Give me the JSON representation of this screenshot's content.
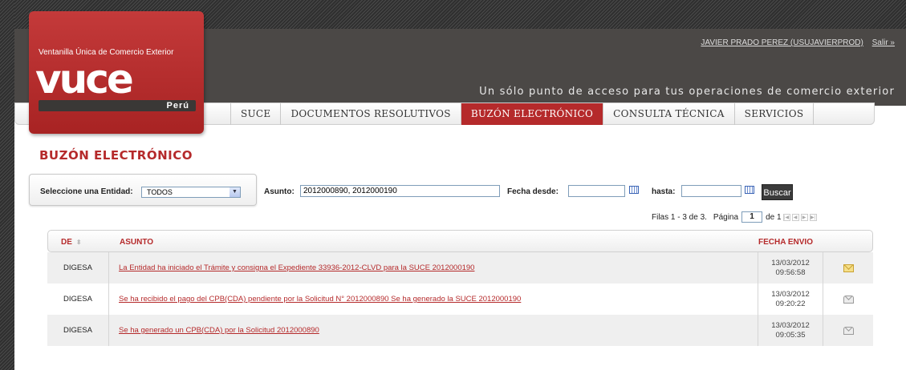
{
  "logo": {
    "top_text": "Ventanilla Única de Comercio Exterior",
    "word": "vuce",
    "country": "Perú"
  },
  "header": {
    "user": "JAVIER PRADO PEREZ (USUJAVIERPROD)",
    "logout": "Salir »",
    "tagline": "Un sólo punto de acceso para tus operaciones de comercio exterior"
  },
  "nav": [
    "SUCE",
    "DOCUMENTOS RESOLUTIVOS",
    "BUZÓN ELECTRÓNICO",
    "CONSULTA TÉCNICA",
    "SERVICIOS"
  ],
  "page": {
    "title": "BUZÓN ELECTRÓNICO"
  },
  "filters": {
    "entity_label": "Seleccione una Entidad:",
    "entity_value": "TODOS",
    "asunto_label": "Asunto:",
    "asunto_value": "2012000890, 2012000190",
    "fecha_desde_label": "Fecha desde:",
    "fecha_desde_value": "",
    "hasta_label": "hasta:",
    "hasta_value": "",
    "search_button": "Buscar"
  },
  "pager": {
    "rows_text": "Filas 1 - 3 de 3.",
    "page_label": "Página",
    "page_value": "1",
    "of_text": "de 1"
  },
  "table": {
    "col_de": "DE",
    "col_asunto": "ASUNTO",
    "col_fecha": "FECHA ENVIO",
    "rows": [
      {
        "de": "DIGESA",
        "asunto": "La Entidad ha iniciado el Trámite y consigna el Expediente 33936-2012-CLVD para la SUCE 2012000190",
        "fecha": "13/03/2012",
        "hora": "09:56:58",
        "icon": "envelope-unread-icon"
      },
      {
        "de": "DIGESA",
        "asunto": "Se ha recibido el pago del CPB(CDA) pendiente por la Solicitud N° 2012000890 Se ha generado la SUCE 2012000190",
        "fecha": "13/03/2012",
        "hora": "09:20:22",
        "icon": "envelope-read-icon"
      },
      {
        "de": "DIGESA",
        "asunto": "Se ha generado un CPB(CDA) por la Solicitud 2012000890",
        "fecha": "13/03/2012",
        "hora": "09:05:35",
        "icon": "envelope-read-icon"
      }
    ]
  },
  "colors": {
    "accent": "#b52a2b",
    "header_bg": "#4b4846"
  }
}
